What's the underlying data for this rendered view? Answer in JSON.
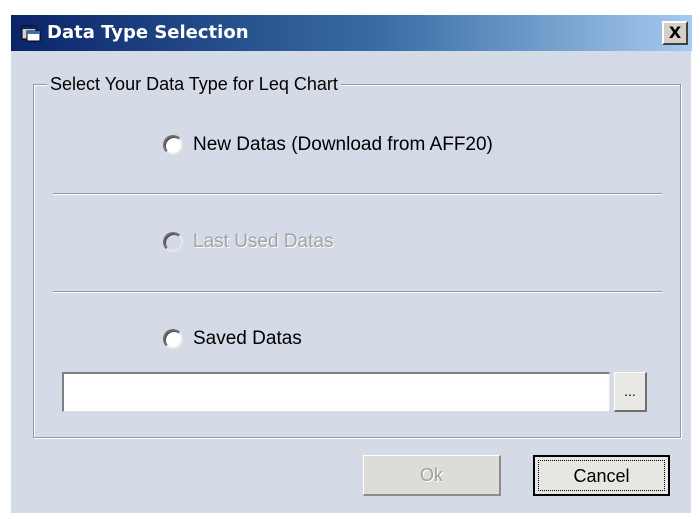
{
  "window": {
    "title": "Data Type Selection",
    "close_label": "X",
    "icon": "app-window-icon"
  },
  "group": {
    "legend": "Select Your Data Type for Leq Chart"
  },
  "options": [
    {
      "label": "New Datas (Download from AFF20)",
      "selected": false,
      "enabled": true
    },
    {
      "label": "Last Used Datas",
      "selected": false,
      "enabled": false
    },
    {
      "label": "Saved Datas",
      "selected": false,
      "enabled": true
    }
  ],
  "path_input": {
    "value": ""
  },
  "browse_button": {
    "label": "..."
  },
  "buttons": {
    "ok": "Ok",
    "cancel": "Cancel"
  },
  "colors": {
    "dialog_bg": "#d4dbe6",
    "title_gradient_start": "#0a246a",
    "title_gradient_end": "#a6caf0",
    "disabled_text": "#a3a3a3"
  }
}
